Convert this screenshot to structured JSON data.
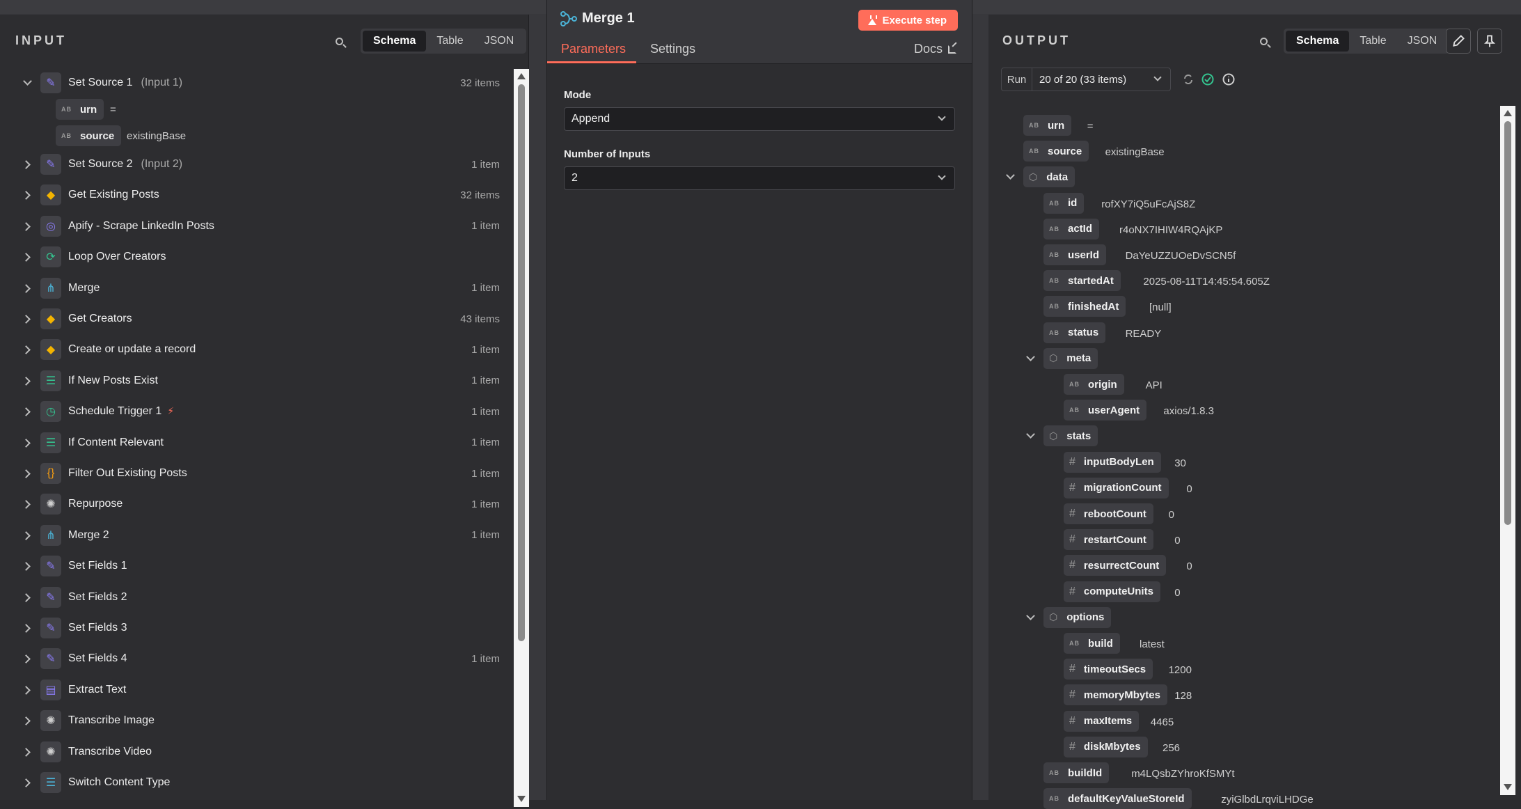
{
  "input_panel": {
    "title": "INPUT",
    "view_tabs": [
      "Schema",
      "Table",
      "JSON"
    ],
    "source_fields": [
      {
        "type": "AB",
        "name": "urn",
        "value": "="
      },
      {
        "type": "AB",
        "name": "source",
        "value": "existingBase"
      }
    ],
    "nodes": [
      {
        "label": "Set Source 1",
        "sub": "(Input 1)",
        "count": "32 items",
        "icon": "pencil-icon",
        "glyph": "✎",
        "color": "#8b7cf6",
        "expanded": true
      },
      {
        "label": "Set Source 2",
        "sub": "(Input 2)",
        "count": "1 item",
        "icon": "pencil-icon",
        "glyph": "✎",
        "color": "#8b7cf6"
      },
      {
        "label": "Get Existing Posts",
        "sub": "",
        "count": "32 items",
        "icon": "airtable-icon",
        "glyph": "◆",
        "color": "#f4b400"
      },
      {
        "label": "Apify - Scrape LinkedIn Posts",
        "sub": "",
        "count": "1 item",
        "icon": "globe-icon",
        "glyph": "◎",
        "color": "#8b7cf6"
      },
      {
        "label": "Loop Over Creators",
        "sub": "",
        "count": "",
        "icon": "loop-icon",
        "glyph": "⟳",
        "color": "#34c38f"
      },
      {
        "label": "Merge",
        "sub": "",
        "count": "1 item",
        "icon": "merge-icon",
        "glyph": "⋔",
        "color": "#4bb4d8"
      },
      {
        "label": "Get Creators",
        "sub": "",
        "count": "43 items",
        "icon": "airtable-icon",
        "glyph": "◆",
        "color": "#f4b400"
      },
      {
        "label": "Create or update a record",
        "sub": "",
        "count": "1 item",
        "icon": "airtable-icon",
        "glyph": "◆",
        "color": "#f4b400"
      },
      {
        "label": "If New Posts Exist",
        "sub": "",
        "count": "1 item",
        "icon": "if-icon",
        "glyph": "☰",
        "color": "#34c38f"
      },
      {
        "label": "Schedule Trigger 1",
        "sub": "",
        "count": "1 item",
        "icon": "clock-icon",
        "glyph": "◷",
        "color": "#34c38f",
        "trigger": true
      },
      {
        "label": "If Content Relevant",
        "sub": "",
        "count": "1 item",
        "icon": "if-icon",
        "glyph": "☰",
        "color": "#34c38f"
      },
      {
        "label": "Filter Out Existing Posts",
        "sub": "",
        "count": "1 item",
        "icon": "code-icon",
        "glyph": "{}",
        "color": "#f39c12"
      },
      {
        "label": "Repurpose",
        "sub": "",
        "count": "1 item",
        "icon": "openai-icon",
        "glyph": "✺",
        "color": "#cfcfcf"
      },
      {
        "label": "Merge 2",
        "sub": "",
        "count": "1 item",
        "icon": "merge-icon",
        "glyph": "⋔",
        "color": "#4bb4d8"
      },
      {
        "label": "Set Fields 1",
        "sub": "",
        "count": "",
        "icon": "pencil-icon",
        "glyph": "✎",
        "color": "#8b7cf6"
      },
      {
        "label": "Set Fields 2",
        "sub": "",
        "count": "",
        "icon": "pencil-icon",
        "glyph": "✎",
        "color": "#8b7cf6"
      },
      {
        "label": "Set Fields 3",
        "sub": "",
        "count": "",
        "icon": "pencil-icon",
        "glyph": "✎",
        "color": "#8b7cf6"
      },
      {
        "label": "Set Fields 4",
        "sub": "",
        "count": "1 item",
        "icon": "pencil-icon",
        "glyph": "✎",
        "color": "#8b7cf6"
      },
      {
        "label": "Extract Text",
        "sub": "",
        "count": "",
        "icon": "document-icon",
        "glyph": "▤",
        "color": "#8b7cf6"
      },
      {
        "label": "Transcribe Image",
        "sub": "",
        "count": "",
        "icon": "openai-icon",
        "glyph": "✺",
        "color": "#cfcfcf"
      },
      {
        "label": "Transcribe Video",
        "sub": "",
        "count": "",
        "icon": "openai-icon",
        "glyph": "✺",
        "color": "#cfcfcf"
      },
      {
        "label": "Switch Content Type",
        "sub": "",
        "count": "",
        "icon": "switch-icon",
        "glyph": "☰",
        "color": "#4bb4d8"
      }
    ]
  },
  "center_panel": {
    "title": "Merge 1",
    "execute_label": "Execute step",
    "tabs": [
      "Parameters",
      "Settings"
    ],
    "docs_label": "Docs",
    "mode_label": "Mode",
    "mode_value": "Append",
    "inputs_label": "Number of Inputs",
    "inputs_value": "2"
  },
  "output_panel": {
    "title": "OUTPUT",
    "view_tabs": [
      "Schema",
      "Table",
      "JSON"
    ],
    "run_label": "Run",
    "run_value": "20 of 20 (33 items)",
    "fields": [
      {
        "depth": 0,
        "type": "AB",
        "name": "urn",
        "value": "="
      },
      {
        "depth": 0,
        "type": "AB",
        "name": "source",
        "value": "existingBase"
      },
      {
        "depth": 0,
        "type": "OBJ",
        "name": "data",
        "value": ""
      },
      {
        "depth": 1,
        "type": "AB",
        "name": "id",
        "value": "rofXY7iQ5uFcAjS8Z"
      },
      {
        "depth": 1,
        "type": "AB",
        "name": "actId",
        "value": "r4oNX7IHIW4RQAjKP"
      },
      {
        "depth": 1,
        "type": "AB",
        "name": "userId",
        "value": "DaYeUZZUOeDvSCN5f"
      },
      {
        "depth": 1,
        "type": "AB",
        "name": "startedAt",
        "value": "2025-08-11T14:45:54.605Z"
      },
      {
        "depth": 1,
        "type": "AB",
        "name": "finishedAt",
        "value": "[null]"
      },
      {
        "depth": 1,
        "type": "AB",
        "name": "status",
        "value": "READY"
      },
      {
        "depth": 1,
        "type": "OBJ",
        "name": "meta",
        "value": ""
      },
      {
        "depth": 2,
        "type": "AB",
        "name": "origin",
        "value": "API"
      },
      {
        "depth": 2,
        "type": "AB",
        "name": "userAgent",
        "value": "axios/1.8.3"
      },
      {
        "depth": 1,
        "type": "OBJ",
        "name": "stats",
        "value": ""
      },
      {
        "depth": 2,
        "type": "#",
        "name": "inputBodyLen",
        "value": "30"
      },
      {
        "depth": 2,
        "type": "#",
        "name": "migrationCount",
        "value": "0"
      },
      {
        "depth": 2,
        "type": "#",
        "name": "rebootCount",
        "value": "0"
      },
      {
        "depth": 2,
        "type": "#",
        "name": "restartCount",
        "value": "0"
      },
      {
        "depth": 2,
        "type": "#",
        "name": "resurrectCount",
        "value": "0"
      },
      {
        "depth": 2,
        "type": "#",
        "name": "computeUnits",
        "value": "0"
      },
      {
        "depth": 1,
        "type": "OBJ",
        "name": "options",
        "value": ""
      },
      {
        "depth": 2,
        "type": "AB",
        "name": "build",
        "value": "latest"
      },
      {
        "depth": 2,
        "type": "#",
        "name": "timeoutSecs",
        "value": "1200"
      },
      {
        "depth": 2,
        "type": "#",
        "name": "memoryMbytes",
        "value": "128"
      },
      {
        "depth": 2,
        "type": "#",
        "name": "maxItems",
        "value": "4465"
      },
      {
        "depth": 2,
        "type": "#",
        "name": "diskMbytes",
        "value": "256"
      },
      {
        "depth": 1,
        "type": "AB",
        "name": "buildId",
        "value": "m4LQsbZYhroKfSMYt"
      },
      {
        "depth": 1,
        "type": "AB",
        "name": "defaultKeyValueStoreId",
        "value": "zyiGlbdLrqviLHDGe"
      }
    ]
  },
  "colors": {
    "accent": "#ff6d5a",
    "panel": "#2d2d30",
    "success": "#34c38f"
  }
}
